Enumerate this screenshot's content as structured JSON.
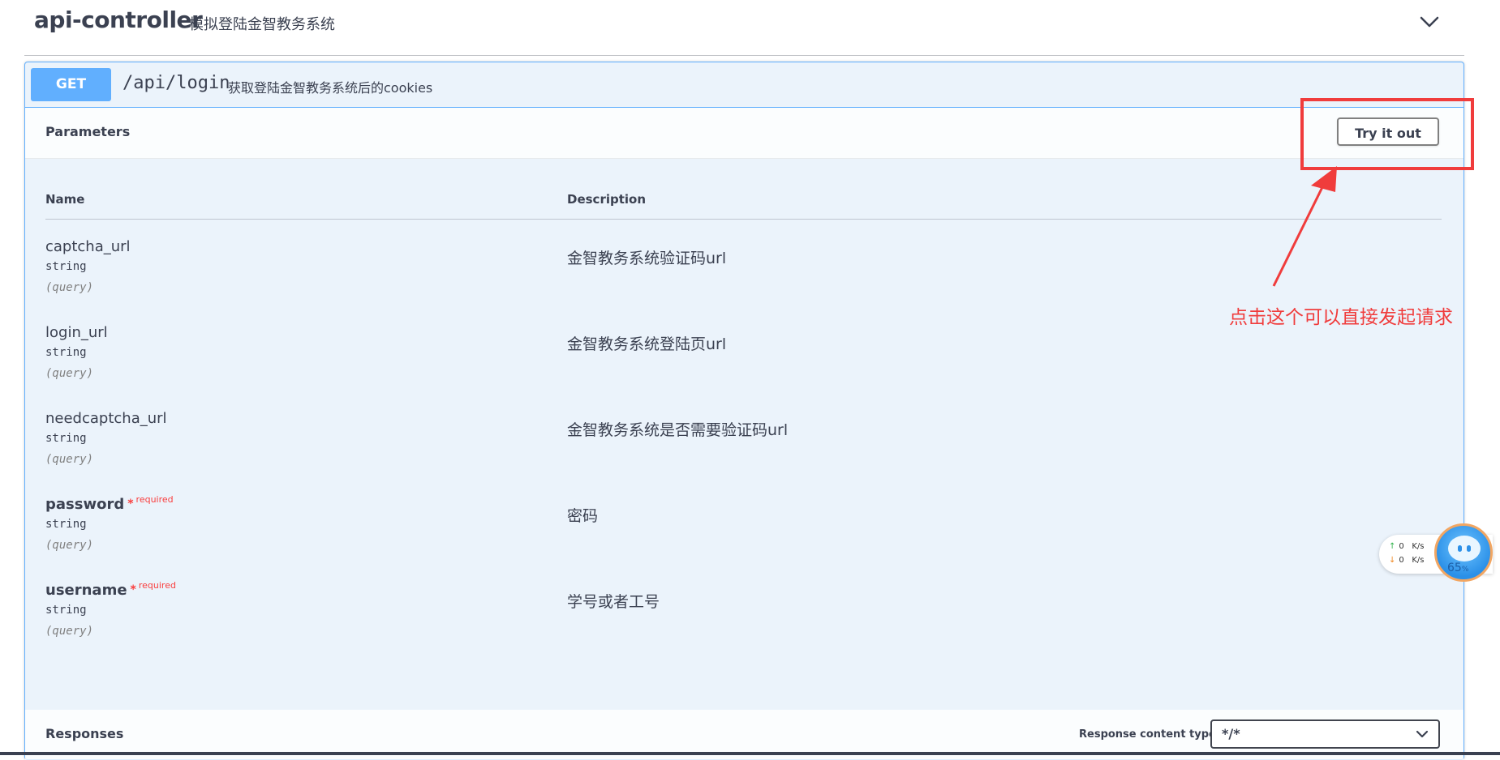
{
  "tag": {
    "name": "api-controller",
    "description": "模拟登陆金智教务系统"
  },
  "operation": {
    "method": "GET",
    "path": "/api/login",
    "summary": "获取登陆金智教务系统后的cookies"
  },
  "parameters_section": {
    "title": "Parameters",
    "try_it_out_label": "Try it out",
    "columns": {
      "name": "Name",
      "description": "Description"
    },
    "params": [
      {
        "name": "captcha_url",
        "type": "string",
        "in": "(query)",
        "required": false,
        "description": "金智教务系统验证码url"
      },
      {
        "name": "login_url",
        "type": "string",
        "in": "(query)",
        "required": false,
        "description": "金智教务系统登陆页url"
      },
      {
        "name": "needcaptcha_url",
        "type": "string",
        "in": "(query)",
        "required": false,
        "description": "金智教务系统是否需要验证码url"
      },
      {
        "name": "password",
        "type": "string",
        "in": "(query)",
        "required": true,
        "required_marker": "*",
        "required_label": "required",
        "description": "密码"
      },
      {
        "name": "username",
        "type": "string",
        "in": "(query)",
        "required": true,
        "required_marker": "*",
        "required_label": "required",
        "description": "学号或者工号"
      }
    ]
  },
  "responses_section": {
    "title": "Responses",
    "content_type_label": "Response content type",
    "content_type_value": "*/*"
  },
  "annotation": {
    "text": "点击这个可以直接发起请求",
    "color": "#f03c3c"
  },
  "net_widget": {
    "upload": "0",
    "download": "0",
    "unit": "K/s",
    "percent": "65",
    "percent_sign": "%"
  },
  "colors": {
    "get_accent": "#61affe",
    "opblock_bg": "#ebf3fb",
    "required": "#f93e3e"
  }
}
